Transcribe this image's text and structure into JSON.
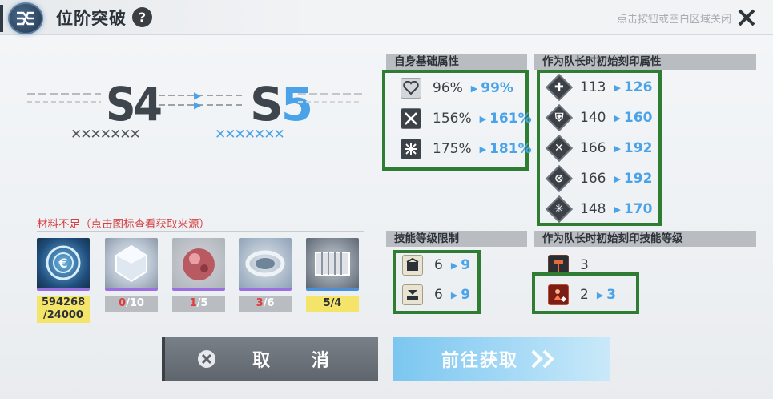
{
  "header": {
    "title": "位阶突破",
    "help": "?",
    "close_hint": "点击按钮或空白区域关闭"
  },
  "rank": {
    "from": "S4",
    "to_letter": "S",
    "to_number": "5",
    "from_marks": "✕✕✕✕✕✕✕",
    "to_marks": "✕✕✕✕✕✕✕"
  },
  "materials": {
    "title": "材料不足（点击图标查看获取来源）",
    "items": [
      {
        "icon": "credit-coin-icon",
        "have": "594268",
        "need": "/24000",
        "sufficient": true
      },
      {
        "icon": "crystal-cube-icon",
        "have": "0",
        "need": "/10",
        "sufficient": false
      },
      {
        "icon": "red-orb-icon",
        "have": "1",
        "need": "/5",
        "sufficient": false
      },
      {
        "icon": "gear-ring-icon",
        "have": "3",
        "need": "/6",
        "sufficient": false
      },
      {
        "icon": "battery-pack-icon",
        "have": "5",
        "need": "/4",
        "sufficient": true
      }
    ]
  },
  "base_stats": {
    "title": "自身基础属性",
    "rows": [
      {
        "icon": "heart-icon",
        "from": "96%",
        "to": "99%"
      },
      {
        "icon": "sword-icon",
        "from": "156%",
        "to": "161%"
      },
      {
        "icon": "shield-burst-icon",
        "from": "175%",
        "to": "181%"
      }
    ]
  },
  "leader_stats": {
    "title": "作为队长时初始刻印属性",
    "rows": [
      {
        "icon": "cross-shield-icon",
        "glyph": "✚",
        "from": "113",
        "to": "126"
      },
      {
        "icon": "armor-icon",
        "glyph": "⛨",
        "from": "140",
        "to": "160"
      },
      {
        "icon": "crossed-swords-icon",
        "glyph": "✕",
        "from": "166",
        "to": "192"
      },
      {
        "icon": "target-icon",
        "glyph": "⊗",
        "from": "166",
        "to": "192"
      },
      {
        "icon": "snowflake-icon",
        "glyph": "✳",
        "from": "148",
        "to": "170"
      }
    ]
  },
  "skill_limit": {
    "title": "技能等级限制",
    "rows": [
      {
        "icon": "skill-box-icon",
        "from": "6",
        "to": "9"
      },
      {
        "icon": "skill-ultimate-icon",
        "from": "6",
        "to": "9"
      }
    ]
  },
  "leader_skill": {
    "title": "作为队长时初始刻印技能等级",
    "rows": [
      {
        "icon": "hammer-icon",
        "value": "3"
      },
      {
        "icon": "fire-user-icon",
        "from": "2",
        "to": "3"
      }
    ]
  },
  "buttons": {
    "cancel": "取 消",
    "obtain": "前往获取"
  },
  "colors": {
    "accent_blue": "#4aa3e8",
    "highlight_green": "#2e7d32",
    "insufficient_red": "#e03b3b",
    "sufficient_yellow": "#f4e46a"
  }
}
